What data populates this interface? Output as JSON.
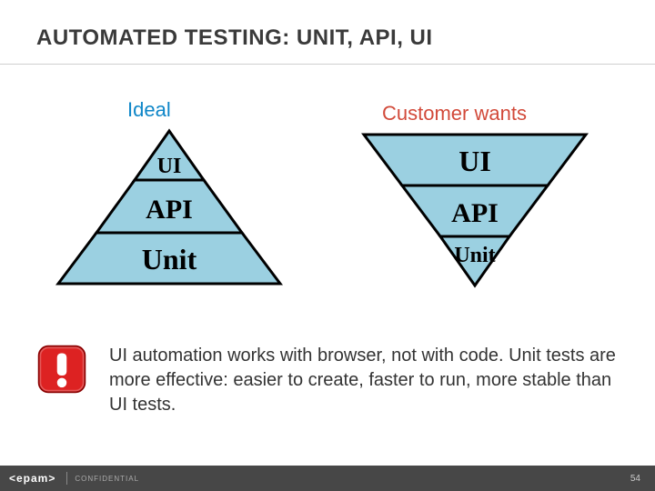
{
  "title": "AUTOMATED TESTING: UNIT, API, UI",
  "labels": {
    "ideal": "Ideal",
    "customer": "Customer wants"
  },
  "pyramid_up": {
    "top": "UI",
    "mid": "API",
    "bot": "Unit"
  },
  "pyramid_down": {
    "top": "UI",
    "mid": "API",
    "bot": "Unit"
  },
  "note": "UI automation works with browser, not with code. Unit tests are more effective: easier to create, faster to run, more stable than UI tests.",
  "footer": {
    "logo": "<epam>",
    "confidential": "CONFIDENTIAL",
    "page": "54"
  },
  "colors": {
    "fill": "#9bd0e1",
    "stroke": "#000000",
    "ideal_label": "#0e86c8",
    "customer_label": "#d24a3a"
  }
}
